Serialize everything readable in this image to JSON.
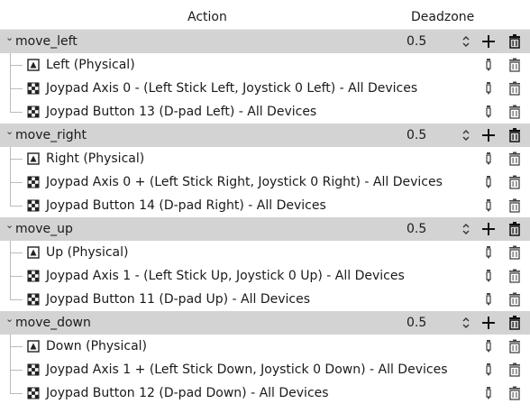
{
  "header": {
    "action_label": "Action",
    "deadzone_label": "Deadzone"
  },
  "actions": [
    {
      "name": "move_left",
      "deadzone": "0.5",
      "events": [
        {
          "type": "key",
          "icon": "keyboard-icon",
          "label": "Left (Physical)"
        },
        {
          "type": "joypad",
          "icon": "joypad-icon",
          "label": "Joypad Axis 0 - (Left Stick Left, Joystick 0 Left) - All Devices"
        },
        {
          "type": "joypad",
          "icon": "joypad-icon",
          "label": "Joypad Button 13 (D-pad Left) - All Devices"
        }
      ]
    },
    {
      "name": "move_right",
      "deadzone": "0.5",
      "events": [
        {
          "type": "key",
          "icon": "keyboard-icon",
          "label": "Right (Physical)"
        },
        {
          "type": "joypad",
          "icon": "joypad-icon",
          "label": "Joypad Axis 0 + (Left Stick Right, Joystick 0 Right) - All Devices"
        },
        {
          "type": "joypad",
          "icon": "joypad-icon",
          "label": "Joypad Button 14 (D-pad Right) - All Devices"
        }
      ]
    },
    {
      "name": "move_up",
      "deadzone": "0.5",
      "events": [
        {
          "type": "key",
          "icon": "keyboard-icon",
          "label": "Up (Physical)"
        },
        {
          "type": "joypad",
          "icon": "joypad-icon",
          "label": "Joypad Axis 1 - (Left Stick Up, Joystick 0 Up) - All Devices"
        },
        {
          "type": "joypad",
          "icon": "joypad-icon",
          "label": "Joypad Button 11 (D-pad Up) - All Devices"
        }
      ]
    },
    {
      "name": "move_down",
      "deadzone": "0.5",
      "events": [
        {
          "type": "key",
          "icon": "keyboard-icon",
          "label": "Down (Physical)"
        },
        {
          "type": "joypad",
          "icon": "joypad-icon",
          "label": "Joypad Axis 1 + (Left Stick Down, Joystick 0 Down) - All Devices"
        },
        {
          "type": "joypad",
          "icon": "joypad-icon",
          "label": "Joypad Button 12 (D-pad Down) - All Devices"
        }
      ]
    }
  ]
}
